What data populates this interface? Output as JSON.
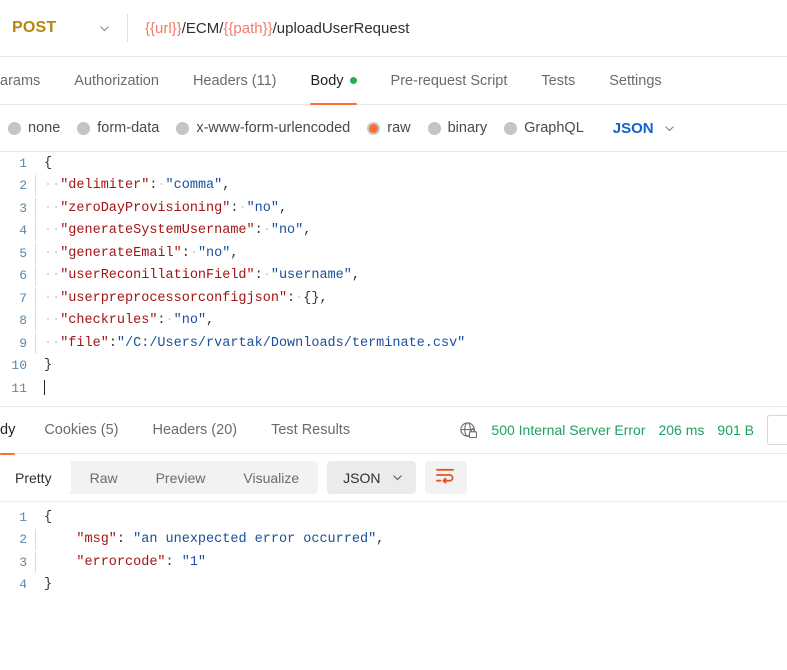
{
  "request": {
    "method": "POST",
    "url_segments": [
      {
        "text": "{{url}}",
        "kind": "var"
      },
      {
        "text": "/ECM/",
        "kind": "plain"
      },
      {
        "text": "{{path}}",
        "kind": "var"
      },
      {
        "text": "/uploadUserRequest",
        "kind": "plain"
      }
    ],
    "url_full": "{{url}}/ECM/{{path}}/uploadUserRequest",
    "tabs": [
      {
        "label": "arams",
        "active": false
      },
      {
        "label": "Authorization",
        "active": false
      },
      {
        "label": "Headers (11)",
        "active": false
      },
      {
        "label": "Body",
        "active": true,
        "dot": true
      },
      {
        "label": "Pre-request Script",
        "active": false
      },
      {
        "label": "Tests",
        "active": false
      },
      {
        "label": "Settings",
        "active": false
      }
    ],
    "body_types": [
      {
        "label": "none",
        "selected": false
      },
      {
        "label": "form-data",
        "selected": false
      },
      {
        "label": "x-www-form-urlencoded",
        "selected": false
      },
      {
        "label": "raw",
        "selected": true
      },
      {
        "label": "binary",
        "selected": false
      },
      {
        "label": "GraphQL",
        "selected": false
      }
    ],
    "format_label": "JSON",
    "body_lines": [
      {
        "num": "1",
        "indent": false,
        "parts": [
          {
            "t": "{",
            "c": "p"
          }
        ]
      },
      {
        "num": "2",
        "indent": true,
        "parts": [
          {
            "t": "··",
            "c": "ws"
          },
          {
            "t": "\"delimiter\"",
            "c": "k"
          },
          {
            "t": ":",
            "c": "p"
          },
          {
            "t": "·",
            "c": "ws"
          },
          {
            "t": "\"comma\"",
            "c": "v"
          },
          {
            "t": ",",
            "c": "p"
          }
        ]
      },
      {
        "num": "3",
        "indent": true,
        "parts": [
          {
            "t": "··",
            "c": "ws"
          },
          {
            "t": "\"zeroDayProvisioning\"",
            "c": "k"
          },
          {
            "t": ":",
            "c": "p"
          },
          {
            "t": "·",
            "c": "ws"
          },
          {
            "t": "\"no\"",
            "c": "v"
          },
          {
            "t": ",",
            "c": "p"
          }
        ]
      },
      {
        "num": "4",
        "indent": true,
        "parts": [
          {
            "t": "··",
            "c": "ws"
          },
          {
            "t": "\"generateSystemUsername\"",
            "c": "k"
          },
          {
            "t": ":",
            "c": "p"
          },
          {
            "t": "·",
            "c": "ws"
          },
          {
            "t": "\"no\"",
            "c": "v"
          },
          {
            "t": ",",
            "c": "p"
          }
        ]
      },
      {
        "num": "5",
        "indent": true,
        "parts": [
          {
            "t": "··",
            "c": "ws"
          },
          {
            "t": "\"generateEmail\"",
            "c": "k"
          },
          {
            "t": ":",
            "c": "p"
          },
          {
            "t": "·",
            "c": "ws"
          },
          {
            "t": "\"no\"",
            "c": "v"
          },
          {
            "t": ",",
            "c": "p"
          }
        ]
      },
      {
        "num": "6",
        "indent": true,
        "parts": [
          {
            "t": "··",
            "c": "ws"
          },
          {
            "t": "\"userReconillationField\"",
            "c": "k"
          },
          {
            "t": ":",
            "c": "p"
          },
          {
            "t": "·",
            "c": "ws"
          },
          {
            "t": "\"username\"",
            "c": "v"
          },
          {
            "t": ",",
            "c": "p"
          }
        ]
      },
      {
        "num": "7",
        "indent": true,
        "parts": [
          {
            "t": "··",
            "c": "ws"
          },
          {
            "t": "\"userpreprocessorconfigjson\"",
            "c": "k"
          },
          {
            "t": ":",
            "c": "p"
          },
          {
            "t": "·",
            "c": "ws"
          },
          {
            "t": "{}",
            "c": "p"
          },
          {
            "t": ",",
            "c": "p"
          }
        ]
      },
      {
        "num": "8",
        "indent": true,
        "parts": [
          {
            "t": "··",
            "c": "ws"
          },
          {
            "t": "\"checkrules\"",
            "c": "k"
          },
          {
            "t": ":",
            "c": "p"
          },
          {
            "t": "·",
            "c": "ws"
          },
          {
            "t": "\"no\"",
            "c": "v"
          },
          {
            "t": ",",
            "c": "p"
          }
        ]
      },
      {
        "num": "9",
        "indent": true,
        "parts": [
          {
            "t": "··",
            "c": "ws"
          },
          {
            "t": "\"file\"",
            "c": "k"
          },
          {
            "t": ":",
            "c": "p"
          },
          {
            "t": "\"/C:/Users/rvartak/Downloads/terminate.csv\"",
            "c": "v"
          }
        ]
      },
      {
        "num": "10",
        "indent": false,
        "parts": [
          {
            "t": "}",
            "c": "p"
          }
        ]
      },
      {
        "num": "11",
        "indent": false,
        "parts": [],
        "caret": true
      }
    ],
    "body_json": {
      "delimiter": "comma",
      "zeroDayProvisioning": "no",
      "generateSystemUsername": "no",
      "generateEmail": "no",
      "userReconillationField": "username",
      "userpreprocessorconfigjson": {},
      "checkrules": "no",
      "file": "/C:/Users/rvartak/Downloads/terminate.csv"
    }
  },
  "response": {
    "tabs": [
      {
        "label": "dy",
        "active": true
      },
      {
        "label": "Cookies (5)",
        "active": false
      },
      {
        "label": "Headers (20)",
        "active": false
      },
      {
        "label": "Test Results",
        "active": false
      }
    ],
    "status": "500 Internal Server Error",
    "time": "206 ms",
    "size": "901 B",
    "view_modes": [
      {
        "label": "Pretty",
        "active": true
      },
      {
        "label": "Raw",
        "active": false
      },
      {
        "label": "Preview",
        "active": false
      },
      {
        "label": "Visualize",
        "active": false
      }
    ],
    "format_label": "JSON",
    "body_lines": [
      {
        "num": "1",
        "indent": false,
        "parts": [
          {
            "t": "{",
            "c": "p"
          }
        ]
      },
      {
        "num": "2",
        "indent": true,
        "parts": [
          {
            "t": "    ",
            "c": "p"
          },
          {
            "t": "\"msg\"",
            "c": "k"
          },
          {
            "t": ": ",
            "c": "p"
          },
          {
            "t": "\"an unexpected error occurred\"",
            "c": "v"
          },
          {
            "t": ",",
            "c": "p"
          }
        ]
      },
      {
        "num": "3",
        "indent": true,
        "parts": [
          {
            "t": "    ",
            "c": "p"
          },
          {
            "t": "\"errorcode\"",
            "c": "k"
          },
          {
            "t": ": ",
            "c": "p"
          },
          {
            "t": "\"1\"",
            "c": "v"
          }
        ]
      },
      {
        "num": "4",
        "indent": false,
        "parts": [
          {
            "t": "}",
            "c": "p"
          }
        ]
      }
    ],
    "body_json": {
      "msg": "an unexpected error occurred",
      "errorcode": "1"
    }
  },
  "colors": {
    "accent": "#ff6c37",
    "method": "#b8860b",
    "success": "#1aa260",
    "link": "#1063cd",
    "dot": "#22b24c",
    "key": "#a31515",
    "value": "#1a4f9c"
  }
}
